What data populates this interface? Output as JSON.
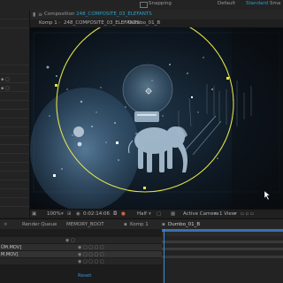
{
  "workspace_bar": {
    "snapping": "Snapping",
    "default": "Default",
    "standard": "Standard",
    "small_screen": "Sma"
  },
  "left_panel": {
    "file_items": [
      "ÜM.MOV]",
      "M.MOV]"
    ]
  },
  "composition": {
    "panel_prefix": "Composition",
    "panel_name": "248_COMPOSITE_03_ELEFANTS",
    "breadcrumb": [
      "Komp 1",
      "248_COMPOSITE_03_ELEFANTS",
      "Dumbo_01_B"
    ]
  },
  "viewer_toolbar": {
    "zoom": "100%",
    "timecode": "0:02:14:06",
    "resolution": "Half",
    "camera": "Active Camera",
    "views": "1 View"
  },
  "timeline_tabs": [
    "Render Queue",
    "MEMORY_BOOT",
    "Komp 1",
    "Dumbo_01_B"
  ],
  "timeline": {
    "reset_label": "Reset"
  },
  "colors": {
    "accent_blue": "#2aa0c8",
    "mask_yellow": "#e3e34a",
    "scene_blue": "#6e9ec0"
  }
}
